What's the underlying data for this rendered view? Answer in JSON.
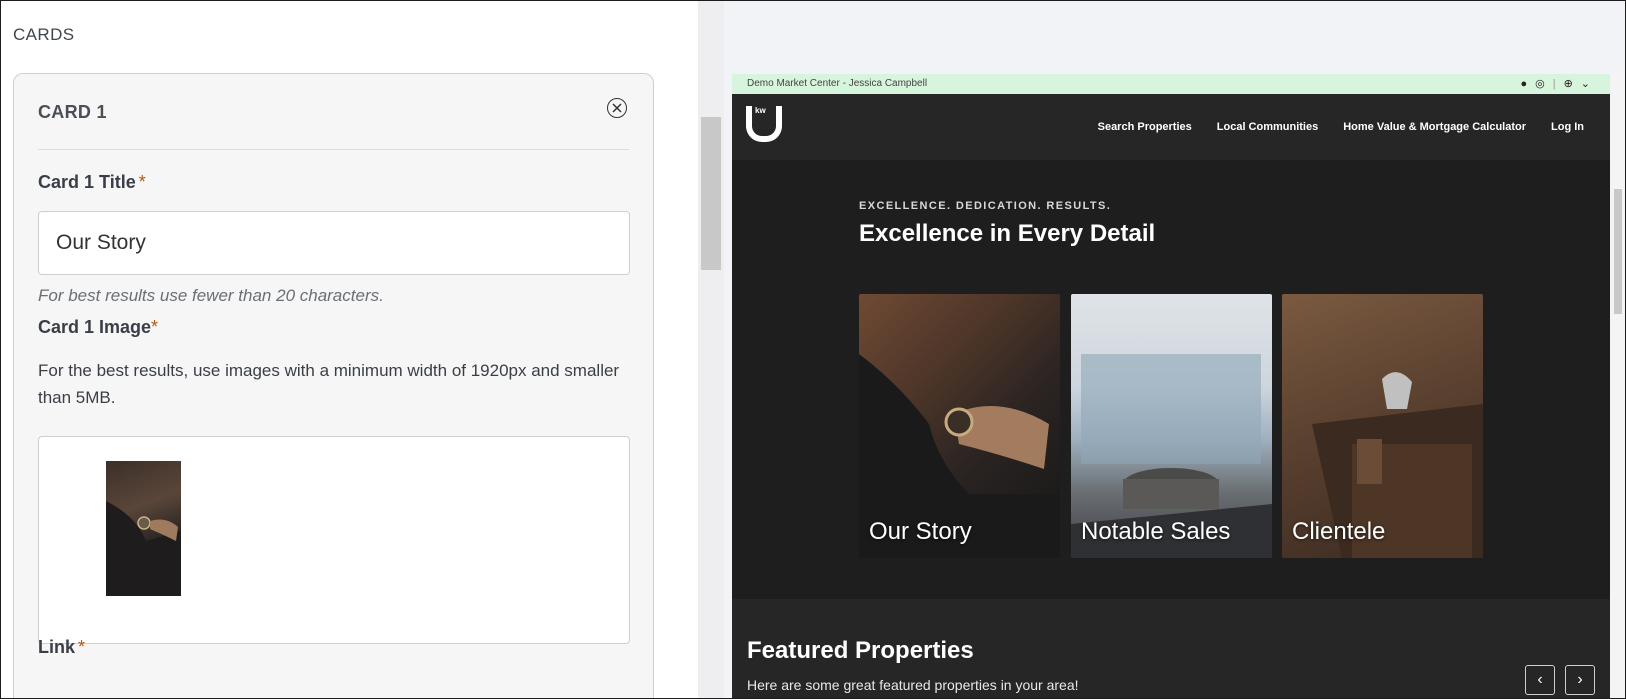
{
  "editor": {
    "section_title": "CARDS",
    "card_heading": "CARD 1",
    "title_field": {
      "label": "Card 1 Title",
      "required_mark": "*",
      "value": "Our Story",
      "hint": "For best results use fewer than 20 characters."
    },
    "image_field": {
      "label": "Card 1 Image",
      "required_mark": "*",
      "description": "For the best results, use images with a minimum width of 1920px and smaller than 5MB."
    },
    "link_field": {
      "label": "Link",
      "required_mark": "*"
    }
  },
  "preview": {
    "topbar": {
      "agent": "Demo Market Center - Jessica Campbell"
    },
    "logo_text": "kw",
    "nav": [
      "Search Properties",
      "Local Communities",
      "Home Value & Mortgage Calculator",
      "Log In"
    ],
    "hero": {
      "eyebrow": "EXCELLENCE. DEDICATION. RESULTS.",
      "title": "Excellence in Every Detail",
      "cards": [
        "Our Story",
        "Notable Sales",
        "Clientele"
      ]
    },
    "featured": {
      "title": "Featured Properties",
      "subtitle": "Here are some great featured properties in your area!"
    }
  },
  "colors": {
    "required_accent": "#b05a10",
    "topbar_bg": "#d7f4dc",
    "site_bg": "#1e1e1e"
  }
}
